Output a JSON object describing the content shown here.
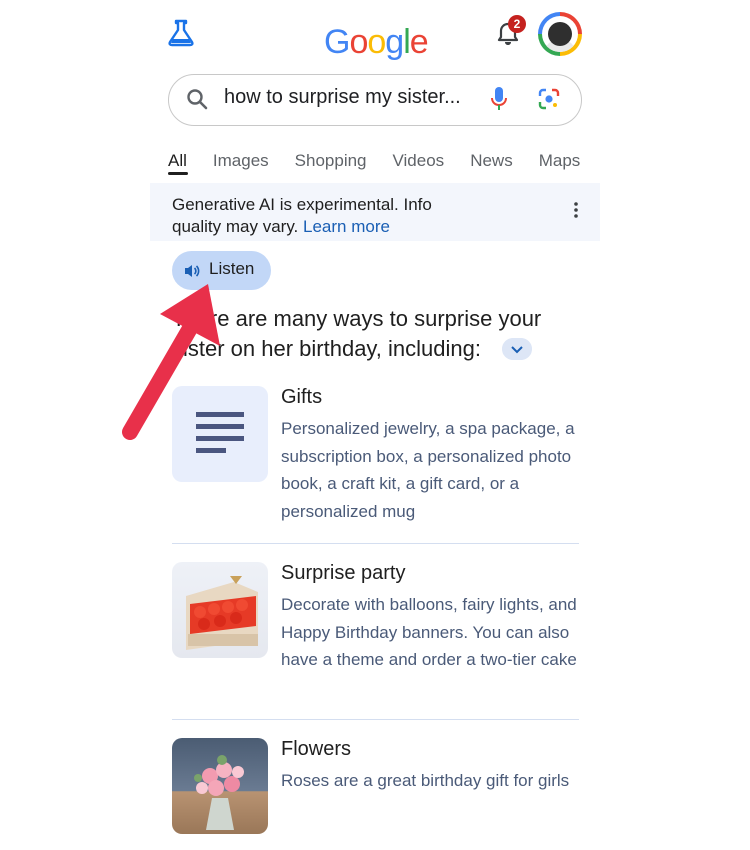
{
  "header": {
    "logo_letters": [
      {
        "char": "G",
        "color": "#4285f4"
      },
      {
        "char": "o",
        "color": "#ea4335"
      },
      {
        "char": "o",
        "color": "#fbbc05"
      },
      {
        "char": "g",
        "color": "#4285f4"
      },
      {
        "char": "l",
        "color": "#34a853"
      },
      {
        "char": "e",
        "color": "#ea4335"
      }
    ],
    "notification_count": "2",
    "labs_icon": "flask-icon",
    "bell_icon": "bell-icon"
  },
  "search": {
    "query": "how to surprise my sister...",
    "icons": [
      "search-icon",
      "mic-icon",
      "lens-icon"
    ]
  },
  "tabs": [
    {
      "label": "All",
      "active": true
    },
    {
      "label": "Images",
      "active": false
    },
    {
      "label": "Shopping",
      "active": false
    },
    {
      "label": "Videos",
      "active": false
    },
    {
      "label": "News",
      "active": false
    },
    {
      "label": "Maps",
      "active": false
    }
  ],
  "notice": {
    "text": "Generative AI is experimental. Info quality may vary.",
    "link": "Learn more"
  },
  "listen": {
    "label": "Listen"
  },
  "answer": {
    "heading": "There are many ways to surprise your sister on her birthday, including:"
  },
  "cards": [
    {
      "title": "Gifts",
      "description": "Personalized jewelry, a spa package, a subscription box, a personalized photo book, a craft kit, a gift card, or a personalized mug"
    },
    {
      "title": "Surprise party",
      "description": "Decorate with balloons, fairy lights, and Happy Birthday banners. You can also have a theme and order a two-tier cake"
    },
    {
      "title": "Flowers",
      "description": "Roses are a great birthday gift for girls"
    }
  ],
  "colors": {
    "accent": "#1a5fb4",
    "listen_chip": "#c2d7f7",
    "arrow": "#e8304a"
  }
}
